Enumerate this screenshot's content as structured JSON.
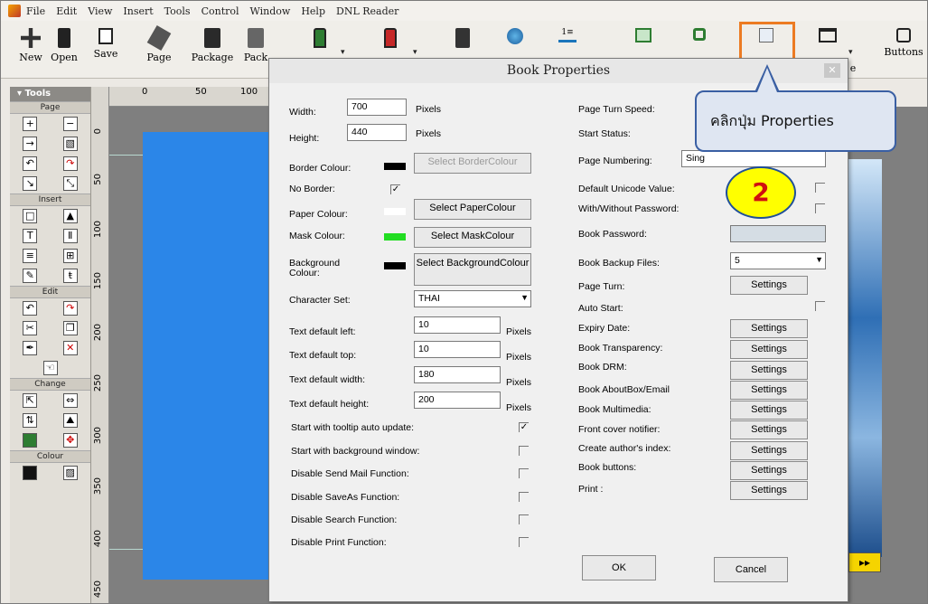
{
  "menu": [
    "File",
    "Edit",
    "View",
    "Insert",
    "Tools",
    "Control",
    "Window",
    "Help",
    "DNL Reader"
  ],
  "toolbar": {
    "new_label": "New",
    "open_label": "Open",
    "save_label": "Save",
    "page_label": "Page",
    "package_label": "Package",
    "pack_label": "Pack",
    "buttons_label": "Buttons",
    "cut_label": "e"
  },
  "sidebar": {
    "tools_label": "Tools",
    "page_section": "Page",
    "insert_section": "Insert",
    "edit_section": "Edit",
    "change_section": "Change",
    "colour_section": "Colour"
  },
  "ruler": {
    "h_ticks": [
      "0",
      "50",
      "100"
    ],
    "v_ticks": [
      "0",
      "50",
      "100",
      "150",
      "200",
      "250",
      "300",
      "350",
      "400",
      "450"
    ]
  },
  "callout": {
    "text": "คลิกปุ่ม Properties",
    "step": "2"
  },
  "dialog": {
    "title": "Book Properties",
    "width_label": "Width:",
    "width_value": "700",
    "height_label": "Height:",
    "height_value": "440",
    "pixels": "Pixels",
    "border_colour_label": "Border Colour:",
    "select_border_colour": "Select BorderColour",
    "no_border_label": "No Border:",
    "paper_colour_label": "Paper Colour:",
    "select_paper_colour": "Select PaperColour",
    "mask_colour_label": "Mask Colour:",
    "select_mask_colour": "Select MaskColour",
    "background_colour_label": "Background Colour:",
    "select_background_colour": "Select BackgroundColour",
    "character_set_label": "Character Set:",
    "character_set_value": "THAI",
    "text_left_label": "Text default left:",
    "text_left_value": "10",
    "text_top_label": "Text default top:",
    "text_top_value": "10",
    "text_width_label": "Text default width:",
    "text_width_value": "180",
    "text_height_label": "Text default height:",
    "text_height_value": "200",
    "tooltip_label": "Start with tooltip auto update:",
    "bgwindow_label": "Start with background window:",
    "sendmail_label": "Disable Send Mail Function:",
    "saveas_label": "Disable SaveAs Function:",
    "search_label": "Disable Search Function:",
    "print_label": "Disable Print Function:",
    "page_turn_speed_label": "Page Turn Speed:",
    "start_status_label": "Start Status:",
    "page_numbering_label": "Page Numbering:",
    "page_numbering_value": "Sing",
    "default_unicode_label": "Default Unicode Value:",
    "with_without_password_label": "With/Without Password:",
    "book_password_label": "Book Password:",
    "backup_files_label": "Book Backup Files:",
    "backup_files_value": "5",
    "page_turn_label": "Page Turn:",
    "auto_start_label": "Auto Start:",
    "expiry_date_label": "Expiry Date:",
    "transparency_label": "Book Transparency:",
    "drm_label": "Book DRM:",
    "aboutbox_label": "Book AboutBox/Email",
    "multimedia_label": "Book Multimedia:",
    "front_cover_label": "Front cover notifier:",
    "authors_index_label": "Create author's index:",
    "book_buttons_label": "Book buttons:",
    "print_right_label": "Print :",
    "settings": "Settings",
    "ok": "OK",
    "cancel": "Cancel",
    "colors": {
      "border": "#000000",
      "paper": "#ffffff",
      "mask": "#22dd22",
      "background": "#000000"
    }
  }
}
